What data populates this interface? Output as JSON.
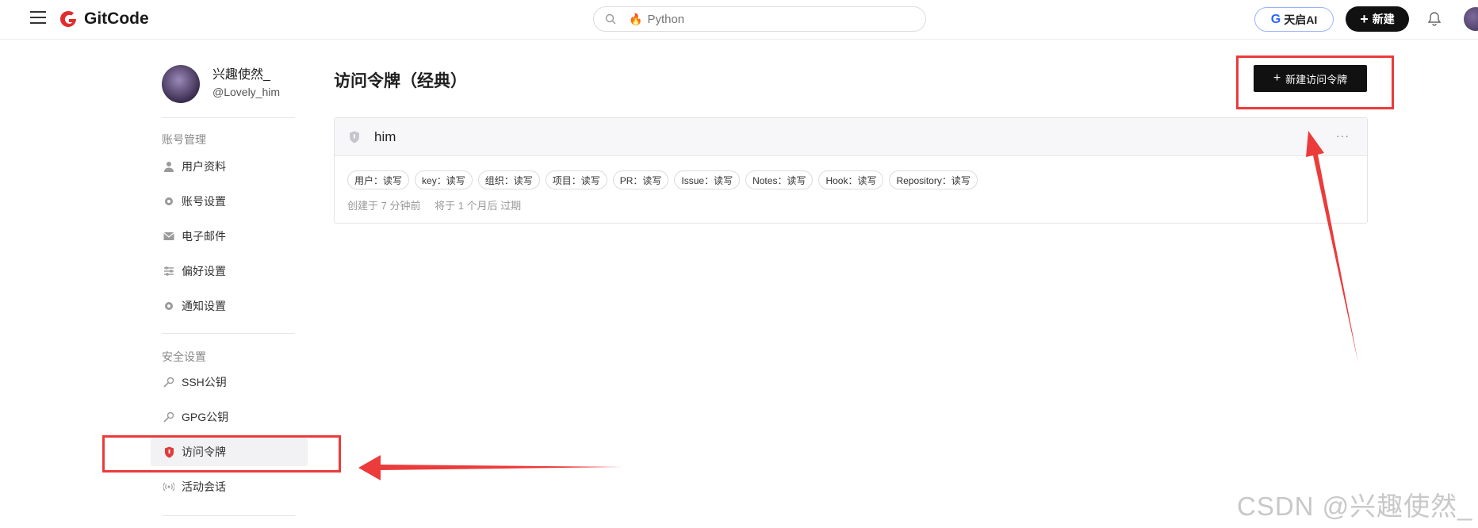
{
  "header": {
    "logo_text": "GitCode",
    "search_placeholder": "Python",
    "ai_button_label": "天启AI",
    "new_button_label": "新建"
  },
  "sidebar": {
    "profile": {
      "name": "兴趣使然_",
      "handle": "@Lovely_him"
    },
    "section_account": "账号管理",
    "account_items": [
      {
        "label": "用户资料",
        "icon": "user-icon"
      },
      {
        "label": "账号设置",
        "icon": "gear-icon"
      },
      {
        "label": "电子邮件",
        "icon": "mail-icon"
      },
      {
        "label": "偏好设置",
        "icon": "sliders-icon"
      },
      {
        "label": "通知设置",
        "icon": "gear-icon"
      }
    ],
    "section_security": "安全设置",
    "security_items": [
      {
        "label": "SSH公钥",
        "icon": "key-icon"
      },
      {
        "label": "GPG公钥",
        "icon": "key-icon"
      },
      {
        "label": "访问令牌",
        "icon": "shield-icon",
        "active": true
      },
      {
        "label": "活动会话",
        "icon": "signal-icon"
      }
    ]
  },
  "main": {
    "title": "访问令牌（经典）",
    "create_button_label": "新建访问令牌",
    "token": {
      "name": "him",
      "more": "···",
      "scopes": [
        "用户：读写",
        "key：读写",
        "组织：读写",
        "项目：读写",
        "PR：读写",
        "Issue：读写",
        "Notes：读写",
        "Hook：读写",
        "Repository：读写"
      ],
      "created": "创建于 7 分钟前",
      "expires": "将于 1 个月后 过期"
    }
  },
  "watermark": "CSDN @兴趣使然_",
  "colors": {
    "accent_red": "#ec3b3b",
    "brand_red": "#e02e2e",
    "button_black": "#111111"
  }
}
